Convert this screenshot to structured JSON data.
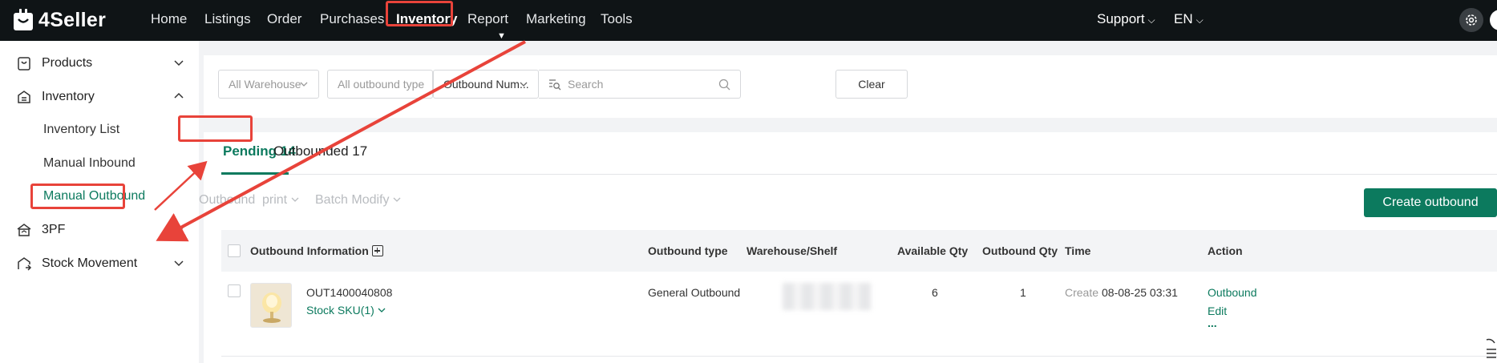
{
  "app": {
    "name": "4Seller"
  },
  "topnav": {
    "items": [
      "Home",
      "Listings",
      "Order",
      "Purchases",
      "Inventory",
      "Report",
      "Marketing",
      "Tools"
    ],
    "support": "Support",
    "language": "EN"
  },
  "sidebar": {
    "groups": [
      {
        "label": "Products",
        "icon": "product-box-icon",
        "expanded": false
      },
      {
        "label": "Inventory",
        "icon": "inventory-icon",
        "expanded": true
      },
      {
        "label": "3PF",
        "icon": "warehouse-3pf-icon",
        "expanded": false
      },
      {
        "label": "Stock Movement",
        "icon": "stock-movement-icon",
        "expanded": false
      }
    ],
    "inventory_items": [
      "Inventory List",
      "Manual Inbound",
      "Manual Outbound"
    ],
    "active_item": "Manual Outbound"
  },
  "filters": {
    "warehouse": "All Warehouse",
    "outbound_type": "All outbound type",
    "search_field": "Outbound Num...",
    "search_placeholder": "Search",
    "clear": "Clear"
  },
  "tabs": [
    {
      "label": "Pending 14",
      "active": true
    },
    {
      "label": "Outbounded 17",
      "active": false
    }
  ],
  "toolbar": {
    "outbound": "Outbound",
    "print": "print",
    "batch_modify": "Batch Modify",
    "create": "Create outbound"
  },
  "table": {
    "headers": [
      "Outbound Information",
      "Outbound type",
      "Warehouse/Shelf",
      "Available Qty",
      "Outbound Qty",
      "Time",
      "Action"
    ],
    "rows": [
      {
        "outbound_no": "OUT1400040808",
        "stock_sku": "Stock SKU(1)",
        "type": "General Outbound",
        "available_qty": "6",
        "outbound_qty": "1",
        "time_label": "Create",
        "time_value": "08-08-25 03:31",
        "actions": [
          "Outbound",
          "Edit",
          "..."
        ]
      }
    ]
  },
  "colors": {
    "accent": "#0c7a5e",
    "topbar": "#0f1416",
    "highlight": "#e8433a"
  }
}
